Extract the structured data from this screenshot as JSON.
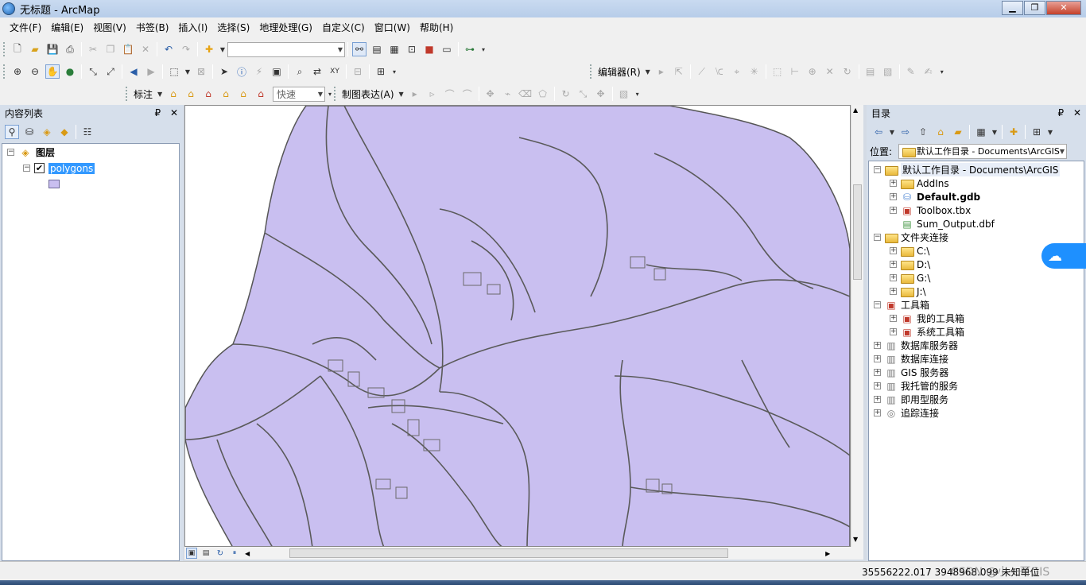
{
  "window": {
    "title": "无标题 - ArcMap",
    "min": "▁",
    "max": "❐",
    "close": "✕"
  },
  "menu": [
    "文件(F)",
    "编辑(E)",
    "视图(V)",
    "书签(B)",
    "插入(I)",
    "选择(S)",
    "地理处理(G)",
    "自定义(C)",
    "窗口(W)",
    "帮助(H)"
  ],
  "toolbar": {
    "editor_label": "编辑器(R)",
    "label_label": "标注",
    "speed_combo": "快速",
    "cartographic_label": "制图表达(A)"
  },
  "toc": {
    "title": "内容列表",
    "pin": "₽",
    "close": "✕",
    "root_label": "图层",
    "layer_label": "polygons"
  },
  "catalog": {
    "title": "目录",
    "pin": "₽",
    "close": "✕",
    "location_label": "位置:",
    "location_value": "默认工作目录 - Documents\\ArcGIS",
    "items": [
      {
        "label": "默认工作目录 - Documents\\ArcGIS",
        "level": 0,
        "exp": "⊟",
        "bold": false,
        "icon": "home-folder-icon"
      },
      {
        "label": "AddIns",
        "level": 1,
        "exp": "⊞",
        "bold": false,
        "icon": "folder-icon"
      },
      {
        "label": "Default.gdb",
        "level": 1,
        "exp": "⊞",
        "bold": true,
        "icon": "geodatabase-icon"
      },
      {
        "label": "Toolbox.tbx",
        "level": 1,
        "exp": "⊞",
        "bold": false,
        "icon": "toolbox-icon"
      },
      {
        "label": "Sum_Output.dbf",
        "level": 1,
        "exp": "",
        "bold": false,
        "icon": "table-icon"
      },
      {
        "label": "文件夹连接",
        "level": 0,
        "exp": "⊟",
        "bold": false,
        "icon": "folder-connection-icon"
      },
      {
        "label": "C:\\",
        "level": 1,
        "exp": "⊞",
        "bold": false,
        "icon": "folder-icon"
      },
      {
        "label": "D:\\",
        "level": 1,
        "exp": "⊞",
        "bold": false,
        "icon": "folder-icon"
      },
      {
        "label": "G:\\",
        "level": 1,
        "exp": "⊞",
        "bold": false,
        "icon": "folder-icon"
      },
      {
        "label": "J:\\",
        "level": 1,
        "exp": "⊞",
        "bold": false,
        "icon": "folder-icon"
      },
      {
        "label": "工具箱",
        "level": 0,
        "exp": "⊟",
        "bold": false,
        "icon": "toolbox-icon"
      },
      {
        "label": "我的工具箱",
        "level": 1,
        "exp": "⊞",
        "bold": false,
        "icon": "toolbox-icon"
      },
      {
        "label": "系统工具箱",
        "level": 1,
        "exp": "⊞",
        "bold": false,
        "icon": "toolbox-icon"
      },
      {
        "label": "数据库服务器",
        "level": 0,
        "exp": "⊞",
        "bold": false,
        "icon": "database-server-icon"
      },
      {
        "label": "数据库连接",
        "level": 0,
        "exp": "⊞",
        "bold": false,
        "icon": "database-connection-icon"
      },
      {
        "label": "GIS 服务器",
        "level": 0,
        "exp": "⊞",
        "bold": false,
        "icon": "gis-server-icon"
      },
      {
        "label": "我托管的服务",
        "level": 0,
        "exp": "⊞",
        "bold": false,
        "icon": "hosted-services-icon"
      },
      {
        "label": "即用型服务",
        "level": 0,
        "exp": "⊞",
        "bold": false,
        "icon": "ready-services-icon"
      },
      {
        "label": "追踪连接",
        "level": 0,
        "exp": "⊞",
        "bold": false,
        "icon": "tracking-connection-icon"
      }
    ]
  },
  "status": {
    "coords": "35556222.017  3948968.099 未知单位",
    "watermark": "CSDN @小一哥GIS"
  },
  "colors": {
    "polygon_fill": "#c9bff0",
    "polygon_stroke": "#5a5a5a",
    "selection": "#3399ff"
  }
}
